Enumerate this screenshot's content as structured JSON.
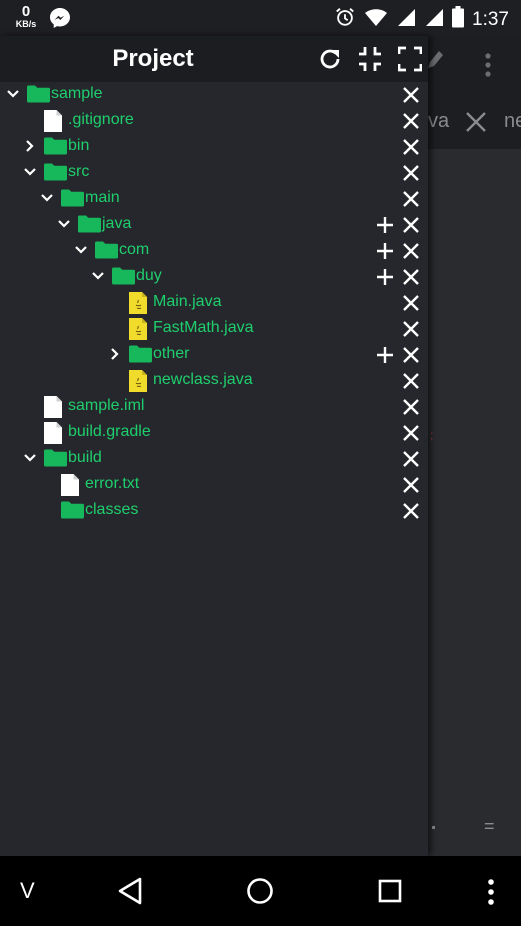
{
  "status_bar": {
    "speed_value": "0",
    "speed_unit": "KB/s",
    "time": "1:37",
    "icons": [
      "messenger-icon",
      "alarm-icon",
      "wifi-icon",
      "signal-icon",
      "signal-icon",
      "battery-icon"
    ]
  },
  "drawer": {
    "title": "Project",
    "header_icons": [
      "refresh-icon",
      "collapse-icon",
      "fullscreen-icon"
    ]
  },
  "tree": [
    {
      "label": "sample",
      "type": "folder",
      "depth": 0,
      "expanded": true,
      "add": false
    },
    {
      "label": ".gitignore",
      "type": "file",
      "depth": 1,
      "add": false
    },
    {
      "label": "bin",
      "type": "folder",
      "depth": 1,
      "expanded": false,
      "add": false
    },
    {
      "label": "src",
      "type": "folder",
      "depth": 1,
      "expanded": true,
      "add": false
    },
    {
      "label": "main",
      "type": "folder",
      "depth": 2,
      "expanded": true,
      "add": false
    },
    {
      "label": "java",
      "type": "folder",
      "depth": 3,
      "expanded": true,
      "add": true
    },
    {
      "label": "com",
      "type": "folder",
      "depth": 4,
      "expanded": true,
      "add": true
    },
    {
      "label": "duy",
      "type": "folder",
      "depth": 5,
      "expanded": true,
      "add": true
    },
    {
      "label": "Main.java",
      "type": "java",
      "depth": 6,
      "add": false
    },
    {
      "label": "FastMath.java",
      "type": "java",
      "depth": 6,
      "add": false
    },
    {
      "label": "other",
      "type": "folder",
      "depth": 6,
      "expanded": false,
      "add": true
    },
    {
      "label": "newclass.java",
      "type": "java",
      "depth": 6,
      "add": false
    },
    {
      "label": "sample.iml",
      "type": "file",
      "depth": 1,
      "add": false
    },
    {
      "label": "build.gradle",
      "type": "file",
      "depth": 1,
      "add": false
    },
    {
      "label": "build",
      "type": "folder",
      "depth": 1,
      "expanded": true,
      "add": false
    },
    {
      "label": "error.txt",
      "type": "file",
      "depth": 2,
      "add": false
    },
    {
      "label": "classes",
      "type": "folder",
      "depth": 2,
      "add": false
    }
  ],
  "editor": {
    "tab_1_label": "va",
    "tab_2_label": "ne",
    "equals_symbol": "="
  },
  "nav_bar": {
    "v_label": "V",
    "icons": [
      "back-icon",
      "home-icon",
      "recents-icon",
      "more-icon"
    ]
  },
  "colors": {
    "accent_green": "#1fcf6d",
    "folder_green": "#17b85c",
    "java_yellow": "#f2dc2b",
    "drawer_bg": "#25272c",
    "header_bg": "#1c1d20"
  }
}
